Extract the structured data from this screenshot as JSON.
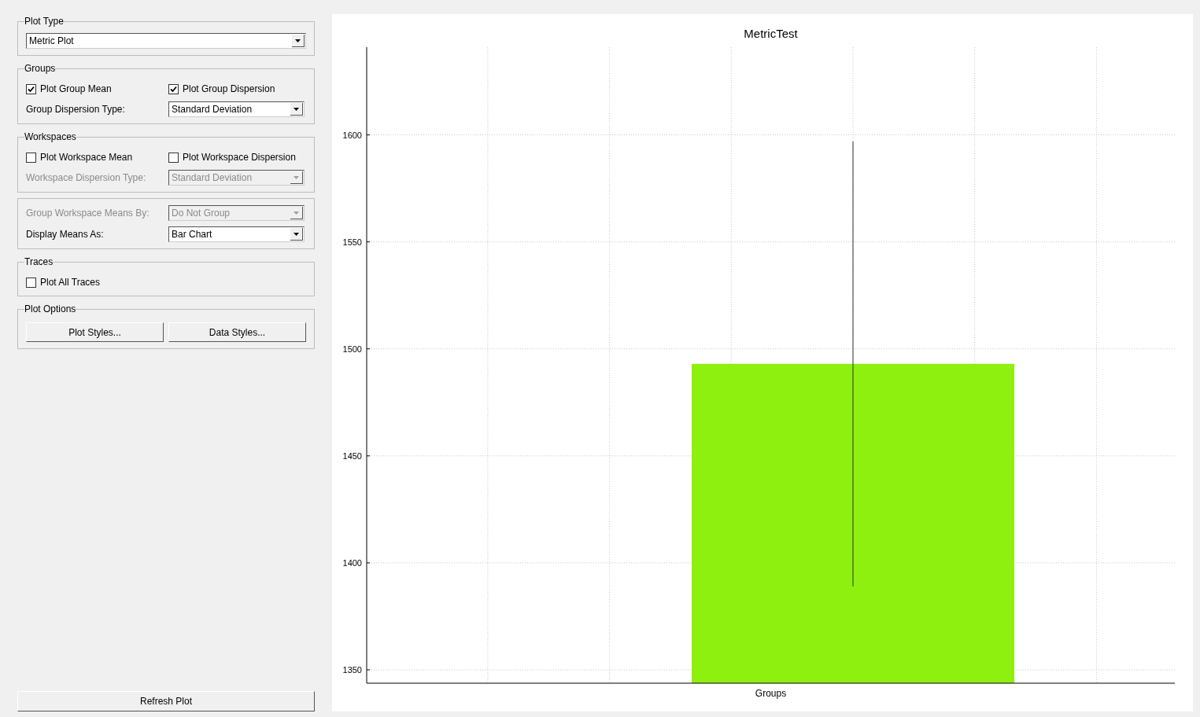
{
  "plot_type": {
    "title": "Plot Type",
    "dropdown": {
      "value": "Metric Plot",
      "disabled": false
    }
  },
  "groups": {
    "title": "Groups",
    "checkboxes": [
      {
        "label": "Plot Group Mean",
        "checked": true
      },
      {
        "label": "Plot Group Dispersion",
        "checked": true
      }
    ],
    "rows": [
      {
        "label": "Group Dispersion Type:",
        "value": "Standard Deviation",
        "disabled": false
      }
    ]
  },
  "workspaces": {
    "title": "Workspaces",
    "checkboxes": [
      {
        "label": "Plot Workspace Mean",
        "checked": false
      },
      {
        "label": "Plot Workspace Dispersion",
        "checked": false
      }
    ],
    "rows": [
      {
        "label": "Workspace Dispersion Type:",
        "value": "Standard Deviation",
        "disabled": true
      }
    ]
  },
  "means": {
    "rows": [
      {
        "label": "Group Workspace Means By:",
        "value": "Do Not Group",
        "disabled": true
      },
      {
        "label": "Display Means As:",
        "value": "Bar Chart",
        "disabled": false
      }
    ]
  },
  "traces": {
    "title": "Traces",
    "checkboxes": [
      {
        "label": "Plot All Traces",
        "checked": false
      }
    ]
  },
  "plot_options": {
    "title": "Plot Options",
    "buttons": [
      "Plot Styles...",
      "Data Styles..."
    ]
  },
  "refresh_button": "Refresh Plot",
  "chart": {
    "chart_data": {
      "type": "bar",
      "title": "MetricTest",
      "categories": [
        "Groups"
      ],
      "series": [
        {
          "color": "#8ef00e",
          "values": [
            1493
          ],
          "errors": [
            104
          ]
        }
      ],
      "ylim": [
        1343.75,
        1641
      ],
      "yticks": [
        1350,
        1400,
        1450,
        1500,
        1550,
        1600
      ],
      "grid": true
    }
  }
}
